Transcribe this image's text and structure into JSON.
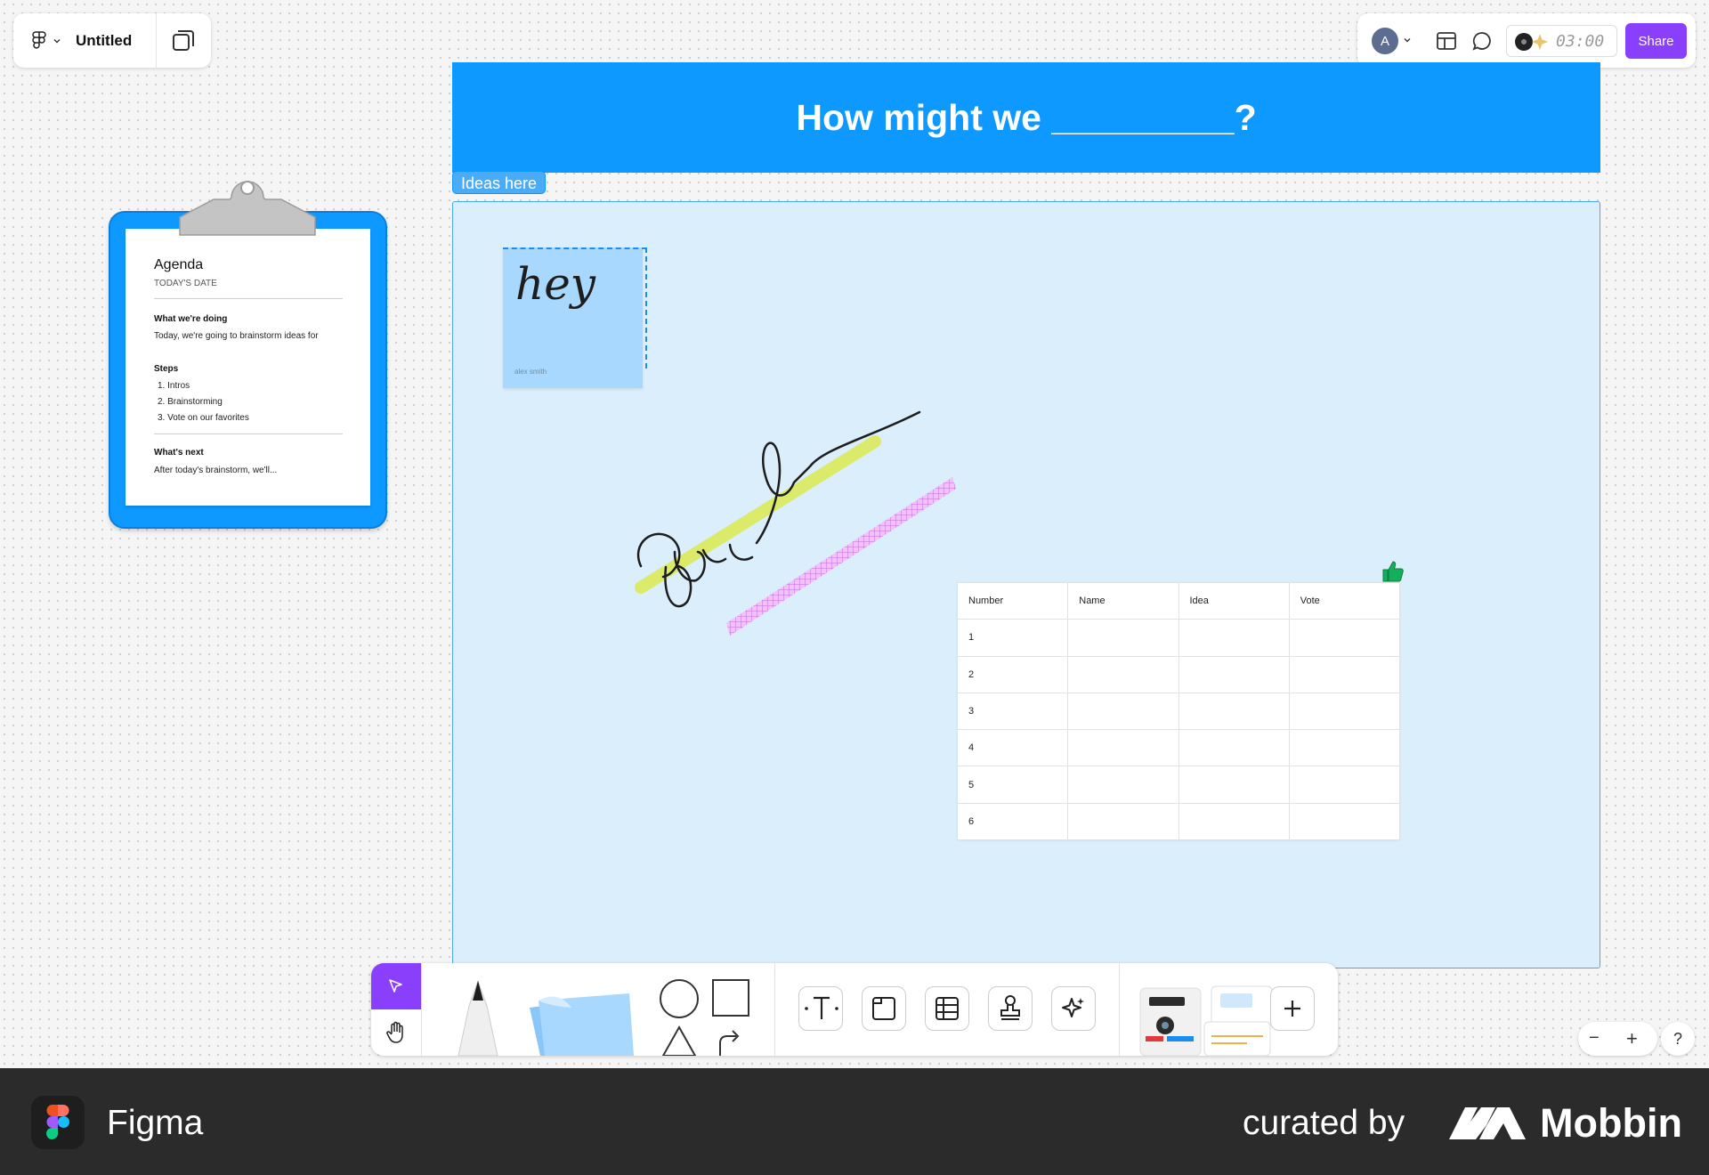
{
  "file": {
    "title": "Untitled"
  },
  "toolbar_top": {
    "avatar_initial": "A",
    "timer": "03:00",
    "share_label": "Share"
  },
  "banner": {
    "title": "How might we _________?"
  },
  "section": {
    "label": "Ideas here"
  },
  "sticky": {
    "text": "hey",
    "author": "alex smith"
  },
  "drawing": {
    "text": "good"
  },
  "agenda": {
    "title": "Agenda",
    "date": "TODAY'S DATE",
    "doing_heading": "What we're doing",
    "doing_text": "Today, we're going to brainstorm ideas for",
    "steps_heading": "Steps",
    "steps": [
      "1. Intros",
      "2. Brainstorming",
      "3. Vote on our favorites"
    ],
    "next_heading": "What's next",
    "next_text": "After today's brainstorm, we'll..."
  },
  "table": {
    "headers": [
      "Number",
      "Name",
      "Idea",
      "Vote"
    ],
    "rows": [
      [
        "1",
        "",
        "",
        ""
      ],
      [
        "2",
        "",
        "",
        ""
      ],
      [
        "3",
        "",
        "",
        ""
      ],
      [
        "4",
        "",
        "",
        ""
      ],
      [
        "5",
        "",
        "",
        ""
      ],
      [
        "6",
        "",
        "",
        ""
      ]
    ]
  },
  "zoom": {
    "minus": "−",
    "plus": "+"
  },
  "help": "?",
  "footer": {
    "app_name": "Figma",
    "curated_by": "curated by",
    "brand": "Mobbin"
  },
  "colors": {
    "accent_purple": "#8a3ffc",
    "banner_blue": "#0d99ff",
    "section_bg": "#dbeefc",
    "sticky_blue": "#a8d8fd",
    "highlighter": "#dcea6a",
    "washi_pink": "#d98be8"
  }
}
